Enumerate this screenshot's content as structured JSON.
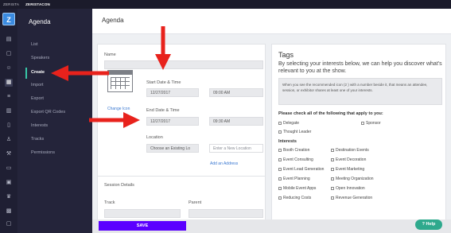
{
  "topbar": {
    "brand1": "ZERISTA",
    "brand2": "ZERISTACON"
  },
  "nav": {
    "header": "Agenda",
    "items": [
      {
        "label": "List"
      },
      {
        "label": "Speakers"
      },
      {
        "label": "Create"
      },
      {
        "label": "Import"
      },
      {
        "label": "Export"
      },
      {
        "label": "Export QR Codes"
      },
      {
        "label": "Interests"
      },
      {
        "label": "Tracks"
      },
      {
        "label": "Permissions"
      }
    ]
  },
  "page": {
    "title": "Agenda"
  },
  "form": {
    "name_label": "Name",
    "name_value": "",
    "start_label": "Start Date & Time",
    "start_date": "12/27/2017",
    "start_time": "09:00 AM",
    "end_label": "End Date & Time",
    "end_date": "12/27/2017",
    "end_time": "09:30 AM",
    "change_icon": "Change Icon",
    "location_label": "Location",
    "location_select": "Choose an Existing Lo",
    "location_new_placeholder": "Enter a New Location",
    "add_address": "Add an Address"
  },
  "session": {
    "title": "Session Details",
    "track_label": "Track",
    "parent_label": "Parent"
  },
  "tags": {
    "title": "Tags",
    "subtitle": "By selecting your interests below, we can help you discover what's relevant to you at the show.",
    "note": "When you see the recommended icon (2 ) with a number beside it, that means an attendee, session, or exhibitor shares at least one of your interests.",
    "check_title": "Please check all of the following that apply to you:",
    "roles": [
      "Delegate",
      "Sponsor",
      "Thought Leader"
    ],
    "interests_title": "Interests",
    "interests_left": [
      "Booth Creation",
      "Event Consulting",
      "Event Lead Generation",
      "Event Planning",
      "Mobile Event Apps",
      "Reducing Costs"
    ],
    "interests_right": [
      "Destination Events",
      "Event Decoration",
      "Event Marketing",
      "Meeting Organization",
      "Open Innovation",
      "Revenue Generation"
    ]
  },
  "actions": {
    "save": "SAVE",
    "help": "Help"
  },
  "colors": {
    "accent_purple": "#5b00ff",
    "help_green": "#2ea98d",
    "annotation_red": "#e8221c",
    "active_marker": "#38c7a7"
  }
}
